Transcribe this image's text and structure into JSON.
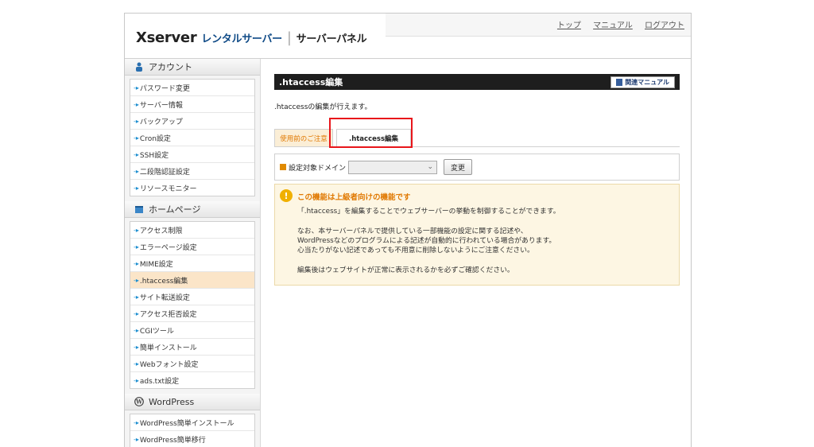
{
  "header": {
    "logo_main": "Xserver",
    "logo_brand": "レンタルサーバー",
    "logo_separator": "|",
    "logo_panel": "サーバーパネル",
    "links": [
      "トップ",
      "マニュアル",
      "ログアウト"
    ]
  },
  "sidebar": {
    "sections": [
      {
        "title": "アカウント",
        "icon": "person-icon",
        "items": [
          "パスワード変更",
          "サーバー情報",
          "バックアップ",
          "Cron設定",
          "SSH設定",
          "二段階認証設定",
          "リソースモニター"
        ]
      },
      {
        "title": "ホームページ",
        "icon": "homepage-icon",
        "items": [
          "アクセス制限",
          "エラーページ設定",
          "MIME設定",
          ".htaccess編集",
          "サイト転送設定",
          "アクセス拒否設定",
          "CGIツール",
          "簡単インストール",
          "Webフォント設定",
          "ads.txt設定"
        ]
      },
      {
        "title": "WordPress",
        "icon": "wordpress-icon",
        "items": [
          "WordPress簡単インストール",
          "WordPress簡単移行"
        ]
      }
    ],
    "active_item": ".htaccess編集",
    "arrow": "-▸"
  },
  "main": {
    "title": ".htaccess編集",
    "manual_button": "関連マニュアル",
    "intro": ".htaccessの編集が行えます。",
    "tabs": [
      "使用前のご注意",
      ".htaccess編集"
    ],
    "active_tab": ".htaccess編集",
    "form": {
      "label": "設定対象ドメイン",
      "select_value": "",
      "change_button": "変更"
    },
    "notice": {
      "title": "この機能は上級者向けの機能です",
      "lines": [
        "「.htaccess」を編集することでウェブサーバーの挙動を制御することができます。",
        "なお、本サーバーパネルで提供している一部機能の設定に関する記述や、",
        "WordPressなどのプログラムによる記述が自動的に行われている場合があります。",
        "心当たりがない記述であっても不用意に削除しないようにご注意ください。",
        "編集後はウェブサイトが正常に表示されるかを必ずご確認ください。"
      ]
    }
  },
  "colors": {
    "highlight": "#e8161b",
    "active_tab": "#e07800",
    "active_row": "#fbe5c8",
    "notice_bg": "#fdf6e3",
    "titlebar": "#1e1e1e"
  }
}
